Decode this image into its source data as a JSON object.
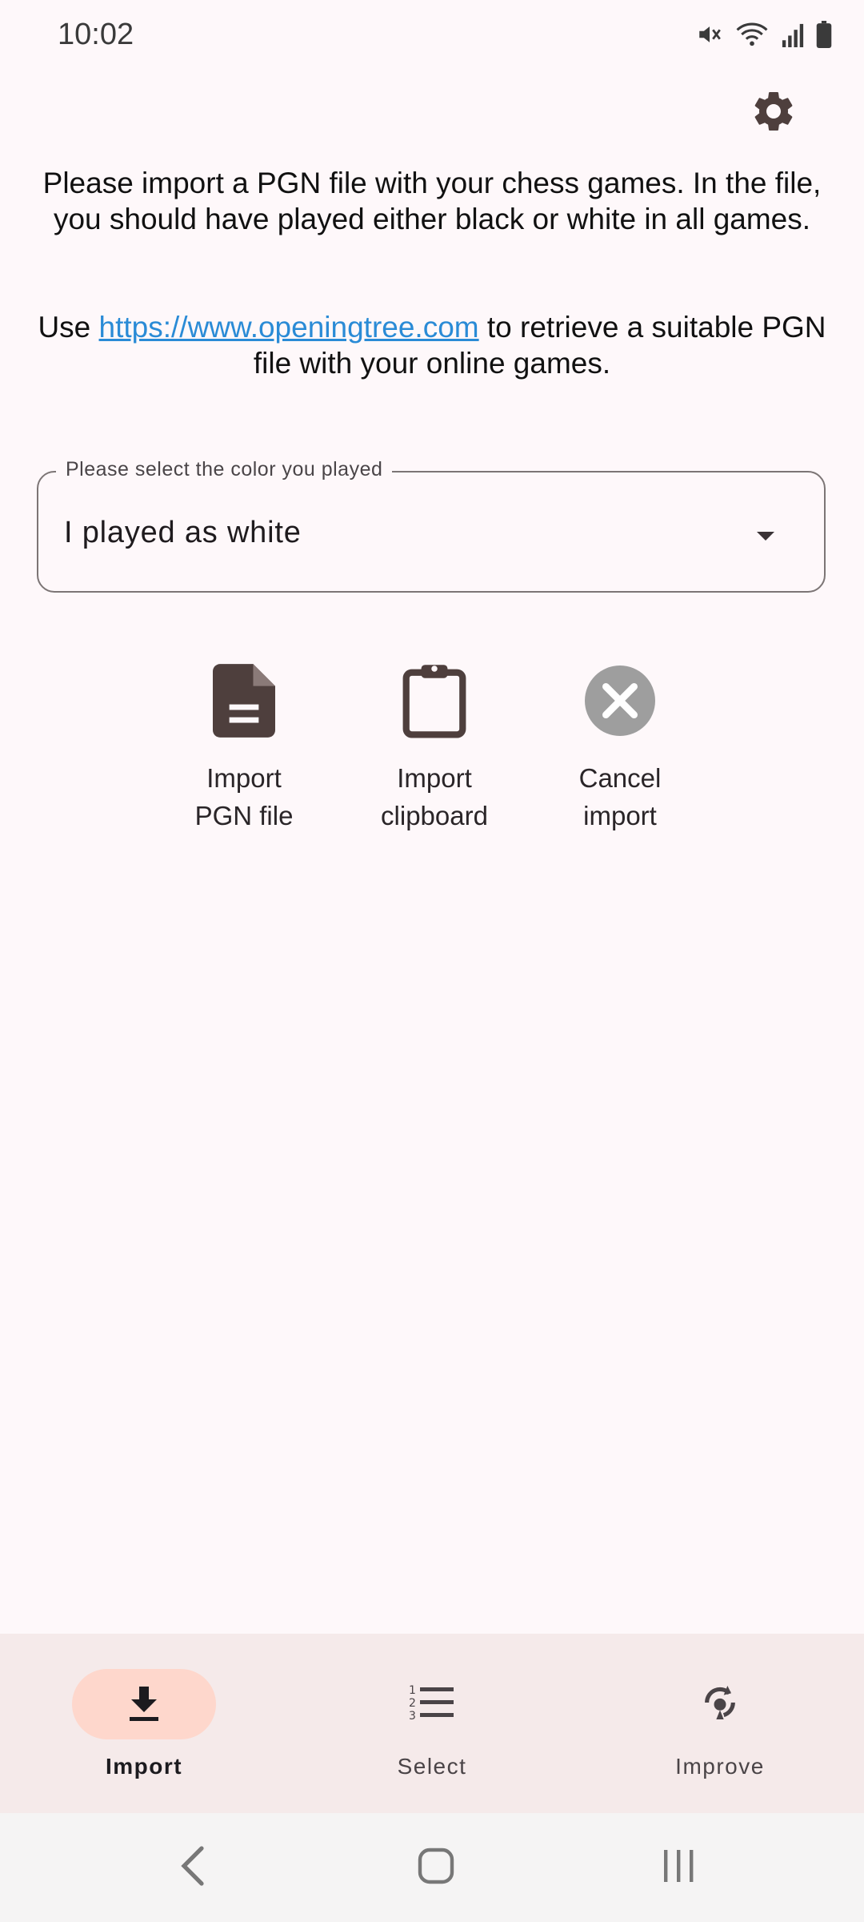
{
  "status_bar": {
    "time": "10:02",
    "icons": [
      "mute-icon",
      "wifi-icon",
      "signal-icon",
      "battery-icon"
    ]
  },
  "header": {
    "settings_icon": "gear-icon"
  },
  "intro": {
    "paragraph1": "Please import a PGN file with your chess games. In the file, you should have played either black or white in all games.",
    "paragraph2_before": "Use ",
    "paragraph2_link": "https://www.openingtree.com",
    "paragraph2_after": " to retrieve a suitable PGN file with your online games."
  },
  "color_select": {
    "label": "Please select the color you played",
    "value": "I played as white"
  },
  "actions": [
    {
      "label": "Import\nPGN file",
      "icon": "file-icon"
    },
    {
      "label": "Import\nclipboard",
      "icon": "clipboard-icon"
    },
    {
      "label": "Cancel\nimport",
      "icon": "cancel-icon"
    }
  ],
  "bottom_nav": {
    "items": [
      {
        "label": "Import",
        "icon": "download-icon",
        "active": true
      },
      {
        "label": "Select",
        "icon": "numbered-list-icon",
        "active": false
      },
      {
        "label": "Improve",
        "icon": "improve-icon",
        "active": false
      }
    ]
  },
  "colors": {
    "background": "#fef8fa",
    "link": "#2a8bd6",
    "nav_background": "#f5eaea",
    "nav_active_pill": "#fed7cc",
    "icon_dark": "#4e3f3d"
  }
}
